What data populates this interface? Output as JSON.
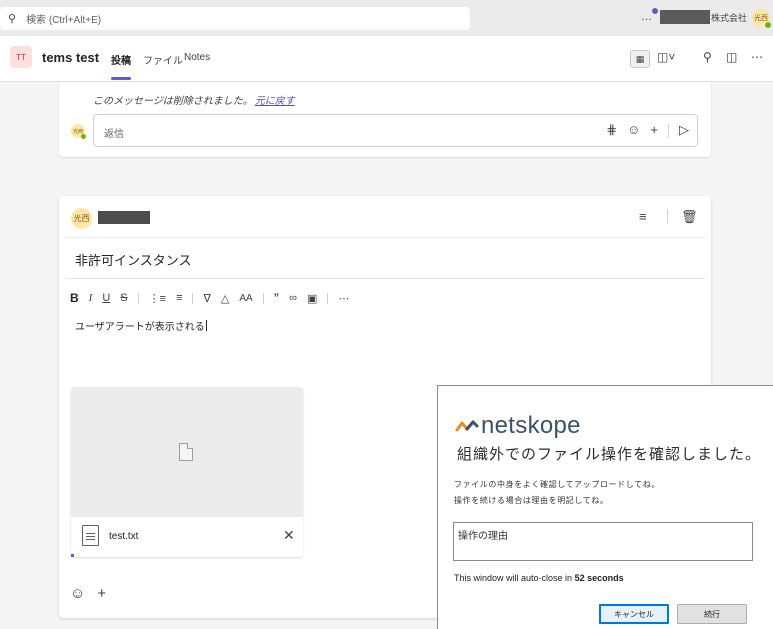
{
  "search": {
    "placeholder": "検索 (Ctrl+Alt+E)"
  },
  "top": {
    "more": "…",
    "tenant_suffix": "株式会社",
    "avatar_initials": "光西"
  },
  "channel": {
    "team_badge": "TT",
    "team_name": "tems test",
    "tabs": [
      "投稿",
      "ファイル",
      "Notes"
    ],
    "active_tab": "投稿"
  },
  "deleted_message": {
    "text": "このメッセージは削除されました。",
    "undo": "元に戻す"
  },
  "reply": {
    "avatar_initials": "光西",
    "placeholder": "返信"
  },
  "compose": {
    "author_initials": "光西",
    "subject": "非許可インスタンス",
    "body": "ユーザアラートが表示される",
    "attachment": {
      "file_name": "test.txt"
    }
  },
  "netskope": {
    "brand": "netskope",
    "title": "組織外でのファイル操作を確認しました。",
    "message_line1": "ファイルの中身をよく確認してアップロードしてね。",
    "message_line2": "操作を続ける場合は理由を明記してね。",
    "reason_placeholder": "操作の理由",
    "countdown_prefix": "This window will auto-close in",
    "countdown_value": "52 seconds",
    "cancel_label": "キャンセル",
    "continue_label": "続行"
  },
  "colors": {
    "accent": "#5b5fc7",
    "presence": "#6bb700",
    "avatar_bg": "#fde6a7",
    "netskope_orange": "#f28b25",
    "netskope_blue": "#3b5268"
  }
}
